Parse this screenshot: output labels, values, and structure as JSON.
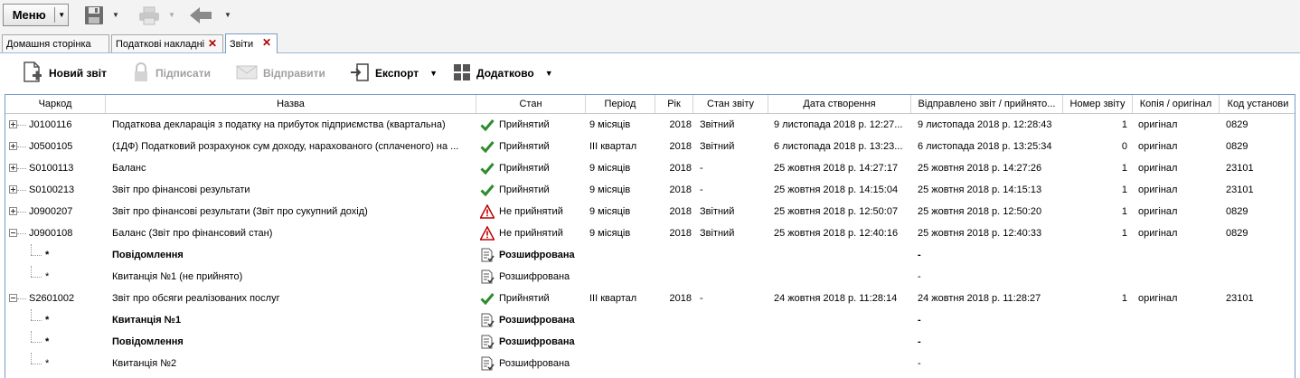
{
  "toolbar": {
    "menu_label": "Меню"
  },
  "tabs": [
    {
      "label": "Домашня сторінка",
      "closable": false
    },
    {
      "label": "Податкові накладні",
      "closable": true
    },
    {
      "label": "Звіти",
      "closable": true,
      "active": true
    }
  ],
  "actions": {
    "new_report": "Новий звіт",
    "sign": "Підписати",
    "send": "Відправити",
    "export": "Експорт",
    "more": "Додатково"
  },
  "columns": [
    "Чаркод",
    "Назва",
    "Стан",
    "Період",
    "Рік",
    "Стан звіту",
    "Дата створення",
    "Відправлено звіт / прийнято...",
    "Номер звіту",
    "Копія / оригінал",
    "Код установи"
  ],
  "rows": [
    {
      "code": "J0100116",
      "name": "Податкова декларація з податку на прибуток підприємства (квартальна)",
      "status": "Прийнятий",
      "status_icon": "check-icon",
      "period": "9 місяців",
      "year": "2018",
      "report_state": "Звітний",
      "created": "9 листопада 2018 р. 12:27...",
      "sent": "9 листопада 2018 р. 12:28:43",
      "number": "1",
      "copy": "оригінал",
      "org_code": "0829",
      "level": 0,
      "expanded": false
    },
    {
      "code": "J0500105",
      "name": "(1ДФ) Податковий розрахунок сум доходу, нарахованого (сплаченого) на ...",
      "status": "Прийнятий",
      "status_icon": "check-icon",
      "period": "III квартал",
      "year": "2018",
      "report_state": "Звітний",
      "created": "6 листопада 2018 р. 13:23...",
      "sent": "6 листопада 2018 р. 13:25:34",
      "number": "0",
      "copy": "оригінал",
      "org_code": "0829",
      "level": 0,
      "expanded": false
    },
    {
      "code": "S0100113",
      "name": "Баланс",
      "status": "Прийнятий",
      "status_icon": "check-icon",
      "period": "9 місяців",
      "year": "2018",
      "report_state": "-",
      "created": "25 жовтня 2018 р. 14:27:17",
      "sent": "25 жовтня 2018 р. 14:27:26",
      "number": "1",
      "copy": "оригінал",
      "org_code": "23101",
      "level": 0,
      "expanded": false
    },
    {
      "code": "S0100213",
      "name": "Звіт про фінансові результати",
      "status": "Прийнятий",
      "status_icon": "check-icon",
      "period": "9 місяців",
      "year": "2018",
      "report_state": "-",
      "created": "25 жовтня 2018 р. 14:15:04",
      "sent": "25 жовтня 2018 р. 14:15:13",
      "number": "1",
      "copy": "оригінал",
      "org_code": "23101",
      "level": 0,
      "expanded": false
    },
    {
      "code": "J0900207",
      "name": "Звіт про фінансові результати (Звіт про сукупний дохід)",
      "status": "Не прийнятий",
      "status_icon": "warning-icon",
      "period": "9 місяців",
      "year": "2018",
      "report_state": "Звітний",
      "created": "25 жовтня 2018 р. 12:50:07",
      "sent": "25 жовтня 2018 р. 12:50:20",
      "number": "1",
      "copy": "оригінал",
      "org_code": "0829",
      "level": 0,
      "expanded": false
    },
    {
      "code": "J0900108",
      "name": "Баланс (Звіт про фінансовий стан)",
      "status": "Не прийнятий",
      "status_icon": "warning-icon",
      "period": "9 місяців",
      "year": "2018",
      "report_state": "Звітний",
      "created": "25 жовтня 2018 р. 12:40:16",
      "sent": "25 жовтня 2018 р. 12:40:33",
      "number": "1",
      "copy": "оригінал",
      "org_code": "0829",
      "level": 0,
      "expanded": true
    },
    {
      "code": "*",
      "name": "Повідомлення",
      "status": "Розшифрована",
      "status_icon": "document-icon",
      "period": "",
      "year": "",
      "report_state": "",
      "created": "",
      "sent": "-",
      "number": "",
      "copy": "",
      "org_code": "",
      "level": 1,
      "bold": true
    },
    {
      "code": "*",
      "name": "Квитанція №1 (не прийнято)",
      "status": "Розшифрована",
      "status_icon": "document-icon",
      "period": "",
      "year": "",
      "report_state": "",
      "created": "",
      "sent": "-",
      "number": "",
      "copy": "",
      "org_code": "",
      "level": 1,
      "bold": false
    },
    {
      "code": "S2601002",
      "name": "Звіт про обсяги реалізованих послуг",
      "status": "Прийнятий",
      "status_icon": "check-icon",
      "period": "III квартал",
      "year": "2018",
      "report_state": "-",
      "created": "24 жовтня 2018 р. 11:28:14",
      "sent": "24 жовтня 2018 р. 11:28:27",
      "number": "1",
      "copy": "оригінал",
      "org_code": "23101",
      "level": 0,
      "expanded": true
    },
    {
      "code": "*",
      "name": "Квитанція №1",
      "status": "Розшифрована",
      "status_icon": "document-icon",
      "period": "",
      "year": "",
      "report_state": "",
      "created": "",
      "sent": "-",
      "number": "",
      "copy": "",
      "org_code": "",
      "level": 1,
      "bold": true
    },
    {
      "code": "*",
      "name": "Повідомлення",
      "status": "Розшифрована",
      "status_icon": "document-icon",
      "period": "",
      "year": "",
      "report_state": "",
      "created": "",
      "sent": "-",
      "number": "",
      "copy": "",
      "org_code": "",
      "level": 1,
      "bold": true
    },
    {
      "code": "*",
      "name": "Квитанція №2",
      "status": "Розшифрована",
      "status_icon": "document-icon",
      "period": "",
      "year": "",
      "report_state": "",
      "created": "",
      "sent": "-",
      "number": "",
      "copy": "",
      "org_code": "",
      "level": 1,
      "bold": false
    }
  ]
}
